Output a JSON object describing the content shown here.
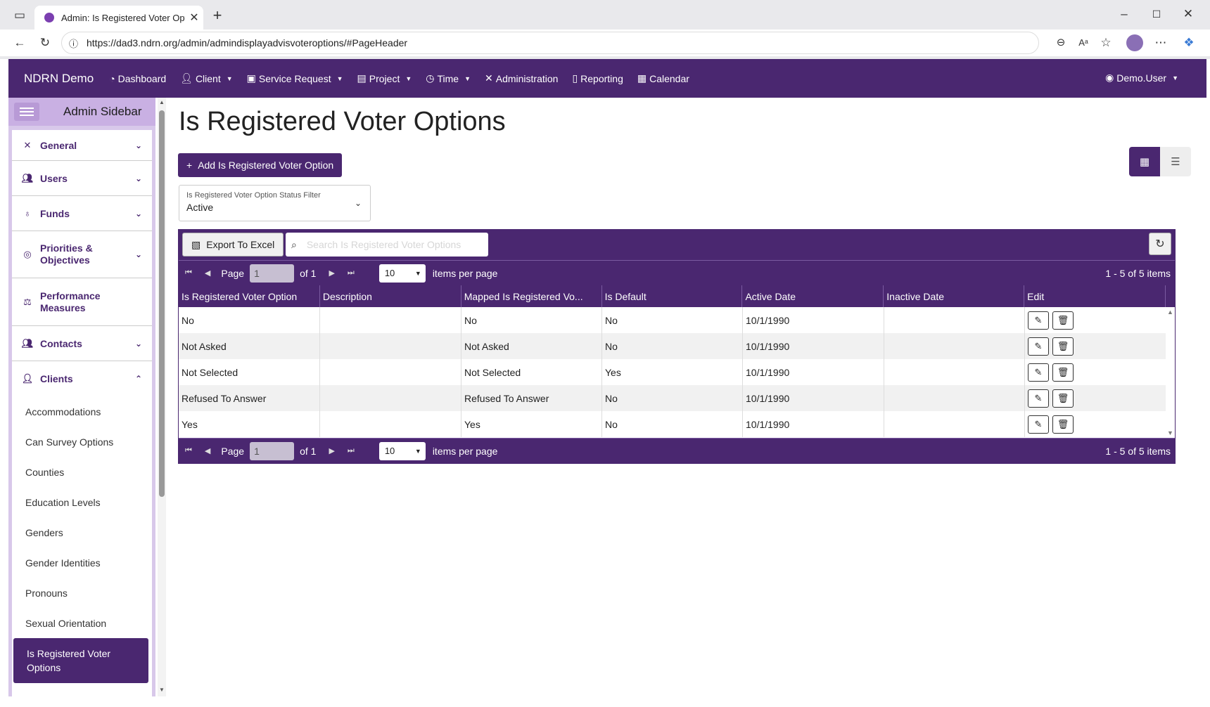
{
  "browser": {
    "tab_title": "Admin: Is Registered Voter Option",
    "url": "https://dad3.ndrn.org/admin/admindisplayadvisvoteroptions/#PageHeader"
  },
  "nav": {
    "brand": "NDRN Demo",
    "items": [
      {
        "label": "Dashboard",
        "icon": "dashboard-icon",
        "dropdown": false
      },
      {
        "label": "Client",
        "icon": "user-icon",
        "dropdown": true
      },
      {
        "label": "Service Request",
        "icon": "briefcase-icon",
        "dropdown": true
      },
      {
        "label": "Project",
        "icon": "clipboard-icon",
        "dropdown": true
      },
      {
        "label": "Time",
        "icon": "clock-icon",
        "dropdown": true
      },
      {
        "label": "Administration",
        "icon": "tools-icon",
        "dropdown": false
      },
      {
        "label": "Reporting",
        "icon": "file-icon",
        "dropdown": false
      },
      {
        "label": "Calendar",
        "icon": "calendar-icon",
        "dropdown": false
      }
    ],
    "user": "Demo.User"
  },
  "sidebar": {
    "title": "Admin Sidebar",
    "sections": [
      {
        "label": "General",
        "icon": "tools-icon",
        "expanded": false
      },
      {
        "label": "Users",
        "icon": "users-icon",
        "expanded": false
      },
      {
        "label": "Funds",
        "icon": "money-bag-icon",
        "expanded": false
      },
      {
        "label": "Priorities & Objectives",
        "icon": "target-icon",
        "expanded": false
      },
      {
        "label": "Performance Measures",
        "icon": "scale-icon",
        "expanded": false
      },
      {
        "label": "Contacts",
        "icon": "users-icon",
        "expanded": false
      },
      {
        "label": "Clients",
        "icon": "user-icon",
        "expanded": true
      }
    ],
    "client_items": [
      "Accommodations",
      "Can Survey Options",
      "Counties",
      "Education Levels",
      "Genders",
      "Gender Identities",
      "Pronouns",
      "Sexual Orientation",
      "Is Registered Voter Options"
    ],
    "active_item": "Is Registered Voter Options"
  },
  "page": {
    "title": "Is Registered Voter Options",
    "add_button": "Add Is Registered Voter Option",
    "filter_label": "Is Registered Voter Option Status Filter",
    "filter_value": "Active"
  },
  "grid": {
    "export_label": "Export To Excel",
    "search_placeholder": "Search Is Registered Voter Options",
    "pager": {
      "page_label": "Page",
      "page_value": "1",
      "of_label": "of 1",
      "per_page": "10",
      "per_page_label": "items per page",
      "info": "1 - 5 of 5 items"
    },
    "columns": [
      "Is Registered Voter Option",
      "Description",
      "Mapped Is Registered Vo...",
      "Is Default",
      "Active Date",
      "Inactive Date",
      "Edit"
    ],
    "rows": [
      [
        "No",
        "",
        "No",
        "No",
        "10/1/1990",
        ""
      ],
      [
        "Not Asked",
        "",
        "Not Asked",
        "No",
        "10/1/1990",
        ""
      ],
      [
        "Not Selected",
        "",
        "Not Selected",
        "Yes",
        "10/1/1990",
        ""
      ],
      [
        "Refused To Answer",
        "",
        "Refused To Answer",
        "No",
        "10/1/1990",
        ""
      ],
      [
        "Yes",
        "",
        "Yes",
        "No",
        "10/1/1990",
        ""
      ]
    ]
  },
  "colors": {
    "primary": "#4a2770",
    "sidebar_bg": "#d8c8ea"
  }
}
